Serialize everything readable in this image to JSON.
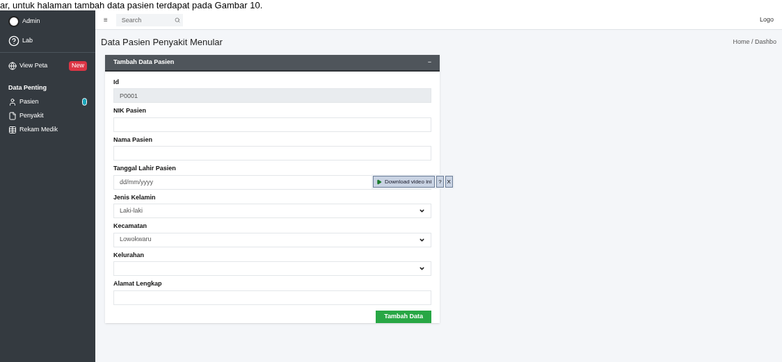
{
  "caption": "ar, untuk halaman tambah data pasien terdapat pada Gambar 10.",
  "sidebar": {
    "user": "Admin",
    "role": "Lab",
    "items": [
      {
        "kind": "link",
        "label": "View Peta",
        "badge": "New"
      },
      {
        "kind": "header",
        "label": "Data Penting"
      },
      {
        "kind": "link",
        "label": "Pasien",
        "badge_dot": true
      },
      {
        "kind": "link",
        "label": "Penyakit"
      },
      {
        "kind": "link",
        "label": "Rekam Medik"
      }
    ]
  },
  "navbar": {
    "menu": "≡",
    "search": {
      "placeholder": "Search"
    },
    "right": "Logo"
  },
  "page": {
    "title": "Data Pasien Penyakit Menular",
    "breadcrumb": "Home / Dashbo"
  },
  "card": {
    "title": "Tambah Data Pasien",
    "collapse": "−",
    "fields": [
      {
        "label": "Id",
        "kind": "text",
        "value": "P0001",
        "disabled": true
      },
      {
        "label": "NIK Pasien",
        "kind": "text",
        "disabled": false
      },
      {
        "label": "Nama Pasien",
        "kind": "text",
        "disabled": false
      },
      {
        "label": "Tanggal Lahir Pasien",
        "kind": "text",
        "value": "dd/mm/yyyy",
        "disabled": false
      },
      {
        "label": "Jenis Kelamin",
        "kind": "select",
        "value": "Laki-laki",
        "disabled": false
      },
      {
        "label": "Kecamatan",
        "kind": "select",
        "value": "Lowokwaru",
        "disabled": false
      },
      {
        "label": "Kelurahan",
        "kind": "select",
        "disabled": false
      },
      {
        "label": "Alamat Lengkap",
        "kind": "text",
        "disabled": false
      }
    ],
    "submit": "Tambah Data"
  },
  "overlay": {
    "button": "Download video ini",
    "help": "?",
    "close": "X"
  }
}
